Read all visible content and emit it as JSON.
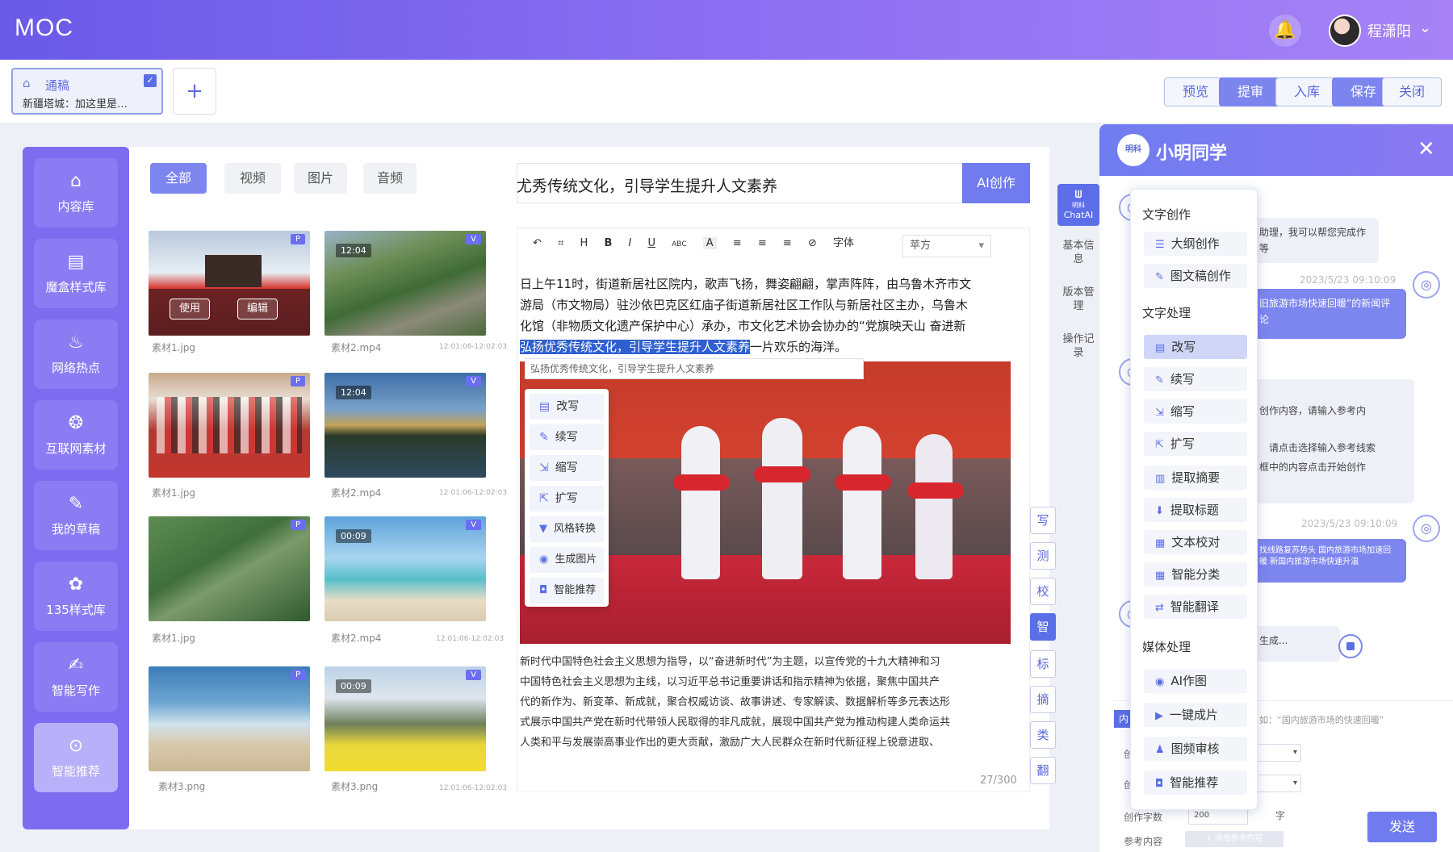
{
  "header": {
    "logo": "MOC",
    "username": "程潇阳"
  },
  "tab": {
    "title": "通稿",
    "subtitle": "新疆塔城：加这里是…",
    "add": "+"
  },
  "actions": {
    "preview": "预览",
    "review": "提审",
    "store": "入库",
    "save": "保存",
    "close": "关闭"
  },
  "sidebar": [
    {
      "label": "内容库",
      "icon": "⌂"
    },
    {
      "label": "魔盒样式库",
      "icon": "▤"
    },
    {
      "label": "网络热点",
      "icon": "♨"
    },
    {
      "label": "互联网素材",
      "icon": "❂"
    },
    {
      "label": "我的草稿",
      "icon": "✎"
    },
    {
      "label": "135样式库",
      "icon": "✿"
    },
    {
      "label": "智能写作",
      "icon": "✍"
    },
    {
      "label": "智能推荐",
      "icon": "⊙"
    }
  ],
  "filters": [
    "全部",
    "视频",
    "图片",
    "音频"
  ],
  "media": [
    {
      "name": "素材1.jpg",
      "type": "P",
      "date": "",
      "use": "使用",
      "edit": "编辑"
    },
    {
      "name": "素材2.mp4",
      "type": "V",
      "date": "12:01:06-12:02:03",
      "duration": "12:04"
    },
    {
      "name": "素材1.jpg",
      "type": "P",
      "date": ""
    },
    {
      "name": "素材2.mp4",
      "type": "V",
      "date": "12:01:06-12:02:03",
      "duration": "12:04"
    },
    {
      "name": "素材1.jpg",
      "type": "P",
      "date": ""
    },
    {
      "name": "素材2.mp4",
      "type": "V",
      "date": "12:01:06-12:02:03",
      "duration": "00:09"
    },
    {
      "name": "素材3.png",
      "type": "P",
      "date": ""
    },
    {
      "name": "素材3.png",
      "type": "V",
      "date": "12:01:06-12:02:03",
      "duration": "00:09"
    }
  ],
  "editor": {
    "title": "尤秀传统文化，引导学生提升人文素养",
    "ai_button": "AI创作",
    "font_label": "字体",
    "font_value": "苹方",
    "toolbar": [
      "↶",
      "⌗",
      "H",
      "B",
      "I",
      "U",
      "ABC",
      "A",
      "≡",
      "≡",
      "≡",
      "⊘"
    ],
    "para": [
      "日上午11时，街道新居社区院内，歌声飞扬，舞姿翩翩，掌声阵阵，由乌鲁木齐市文",
      "游局（市文物局）驻沙依巴克区红庙子街道新居社区工作队与新居社区主办，乌鲁木",
      "化馆（非物质文化遗产保护中心）承办，市文化艺术协会协办的“党旗映天山 奋进新"
    ],
    "highlight": "弘扬优秀传统文化，引导学生提升人文素养",
    "para_tail": "一片欢乐的海洋。",
    "selection": "弘扬优秀传统文化，引导学生提升人文素养",
    "context_menu": [
      "改写",
      "续写",
      "缩写",
      "扩写",
      "风格转换",
      "生成图片",
      "智能推荐"
    ],
    "para2": [
      "新时代中国特色社会主义思想为指导，以“奋进新时代”为主题，以宣传党的十九大精神和习",
      "中国特色社会主义思想为主线，以习近平总书记重要讲话和指示精神为依据，聚焦中国共产",
      "代的新作为、新变革、新成就，聚合权威访谈、故事讲述、专家解读、数据解析等多元表达形",
      "式展示中国共产党在新时代带领人民取得的非凡成就，展现中国共产党为推动构建人类命运共",
      "人类和平与发展崇高事业作出的更大贡献，激励广大人民群众在新时代新征程上锐意进取、"
    ],
    "counter": "27/300"
  },
  "sidenav": {
    "chat": "ChatAI",
    "brand": "明科",
    "basic": "基本信息",
    "version": "版本管理",
    "log": "操作记录"
  },
  "vertical_tools": [
    "写",
    "测",
    "校",
    "智",
    "标",
    "摘",
    "类",
    "翻"
  ],
  "chat": {
    "title": "小明同学",
    "brand": "明科",
    "msg1": "助理，我可以帮您完成作等",
    "time1": "2023/5/23 09:10:09",
    "msg2": "旧旅游市场快速回暖”的新闻评论",
    "msg3_a": "创作内容，请输入参考内",
    "msg3_b": "请点击选择输入参考线索",
    "msg3_c": "框中的内容点击开始创作",
    "time2": "2023/5/23 09:10:09",
    "msg4": "找线路复苏势头 国内旅游市场加速回暖 新国内旅游市场快速升温",
    "generating": "生成...",
    "placeholder": "如：“国内旅游市场的快速回暖”",
    "word_label": "创作字数",
    "word_value": "200",
    "word_unit": "字",
    "ref_label": "参考内容",
    "ref_button": "+ 添加参考内容",
    "send": "发送",
    "tab_label": "内",
    "c1": "创",
    "c2": "创"
  },
  "popup": {
    "groups": [
      {
        "title": "文字创作",
        "items": [
          "大纲创作",
          "图文稿创作"
        ]
      },
      {
        "title": "文字处理",
        "items": [
          "改写",
          "续写",
          "缩写",
          "扩写",
          "提取摘要",
          "提取标题",
          "文本校对",
          "智能分类",
          "智能翻译"
        ]
      },
      {
        "title": "媒体处理",
        "items": [
          "AI作图",
          "一键成片",
          "图频审核",
          "智能推荐"
        ]
      }
    ]
  }
}
